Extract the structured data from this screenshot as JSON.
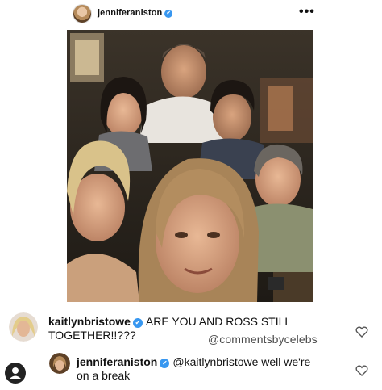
{
  "post": {
    "username": "jenniferaniston",
    "verified_mark": "✔",
    "more_label": "•••"
  },
  "comments": [
    {
      "username": "kaitlynbristowe",
      "text_line1": "ARE YOU AND ROSS STILL",
      "text_line2": "TOGETHER!!???"
    },
    {
      "username": "jenniferaniston",
      "mention": "@kaitlynbristowe",
      "text_line1": "well we're",
      "text_line2": "on a break"
    }
  ],
  "watermark": "@commentsbycelebs",
  "icons": {
    "avatar": "avatar-icon",
    "heart": "heart-icon",
    "user": "user-icon",
    "verified": "verified-badge-icon"
  },
  "colors": {
    "verified": "#3897f0",
    "text": "#111111"
  }
}
